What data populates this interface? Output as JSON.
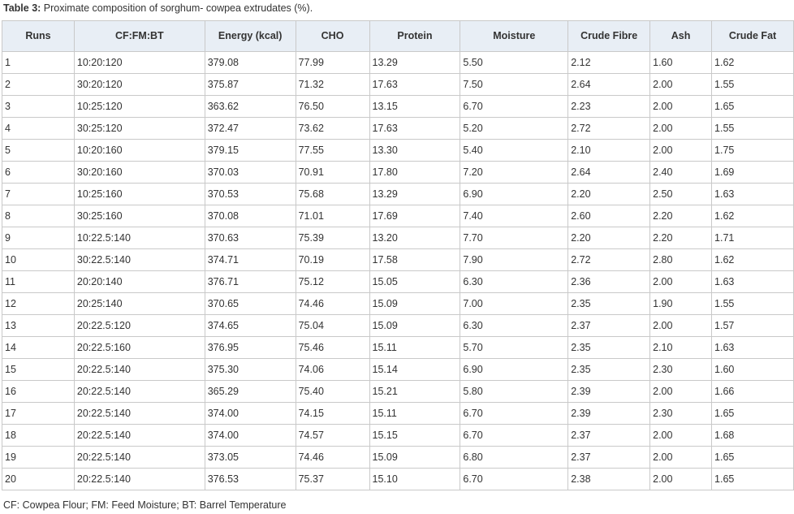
{
  "caption": {
    "label": "Table 3:",
    "text": "Proximate composition of sorghum- cowpea extrudates (%)."
  },
  "table": {
    "headers": [
      "Runs",
      "CF:FM:BT",
      "Energy (kcal)",
      "CHO",
      "Protein",
      "Moisture",
      "Crude Fibre",
      "Ash",
      "Crude Fat"
    ],
    "rows": [
      [
        "1",
        "10:20:120",
        "379.08",
        "77.99",
        "13.29",
        "5.50",
        "2.12",
        "1.60",
        "1.62"
      ],
      [
        "2",
        "30:20:120",
        "375.87",
        "71.32",
        "17.63",
        "7.50",
        "2.64",
        "2.00",
        "1.55"
      ],
      [
        "3",
        "10:25:120",
        "363.62",
        "76.50",
        "13.15",
        "6.70",
        "2.23",
        "2.00",
        "1.65"
      ],
      [
        "4",
        "30:25:120",
        "372.47",
        "73.62",
        "17.63",
        "5.20",
        "2.72",
        "2.00",
        "1.55"
      ],
      [
        "5",
        "10:20:160",
        "379.15",
        "77.55",
        "13.30",
        "5.40",
        "2.10",
        "2.00",
        "1.75"
      ],
      [
        "6",
        "30:20:160",
        "370.03",
        "70.91",
        "17.80",
        "7.20",
        "2.64",
        "2.40",
        "1.69"
      ],
      [
        "7",
        "10:25:160",
        "370.53",
        "75.68",
        "13.29",
        "6.90",
        "2.20",
        "2.50",
        "1.63"
      ],
      [
        "8",
        "30:25:160",
        "370.08",
        "71.01",
        "17.69",
        "7.40",
        "2.60",
        "2.20",
        "1.62"
      ],
      [
        "9",
        "10:22.5:140",
        "370.63",
        "75.39",
        "13.20",
        "7.70",
        "2.20",
        "2.20",
        "1.71"
      ],
      [
        "10",
        "30:22.5:140",
        "374.71",
        "70.19",
        "17.58",
        "7.90",
        "2.72",
        "2.80",
        "1.62"
      ],
      [
        "11",
        "20:20:140",
        "376.71",
        "75.12",
        "15.05",
        "6.30",
        "2.36",
        "2.00",
        "1.63"
      ],
      [
        "12",
        "20:25:140",
        "370.65",
        "74.46",
        "15.09",
        "7.00",
        "2.35",
        "1.90",
        "1.55"
      ],
      [
        "13",
        "20:22.5:120",
        "374.65",
        "75.04",
        "15.09",
        "6.30",
        "2.37",
        "2.00",
        "1.57"
      ],
      [
        "14",
        "20:22.5:160",
        "376.95",
        "75.46",
        "15.11",
        "5.70",
        "2.35",
        "2.10",
        "1.63"
      ],
      [
        "15",
        "20:22.5:140",
        "375.30",
        "74.06",
        "15.14",
        "6.90",
        "2.35",
        "2.30",
        "1.60"
      ],
      [
        "16",
        "20:22.5:140",
        "365.29",
        "75.40",
        "15.21",
        "5.80",
        "2.39",
        "2.00",
        "1.66"
      ],
      [
        "17",
        "20:22.5:140",
        "374.00",
        "74.15",
        "15.11",
        "6.70",
        "2.39",
        "2.30",
        "1.65"
      ],
      [
        "18",
        "20:22.5:140",
        "374.00",
        "74.57",
        "15.15",
        "6.70",
        "2.37",
        "2.00",
        "1.68"
      ],
      [
        "19",
        "20:22.5:140",
        "373.05",
        "74.46",
        "15.09",
        "6.80",
        "2.37",
        "2.00",
        "1.65"
      ],
      [
        "20",
        "20:22.5:140",
        "376.53",
        "75.37",
        "15.10",
        "6.70",
        "2.38",
        "2.00",
        "1.65"
      ]
    ]
  },
  "footnote": "CF: Cowpea Flour; FM: Feed Moisture; BT: Barrel Temperature"
}
